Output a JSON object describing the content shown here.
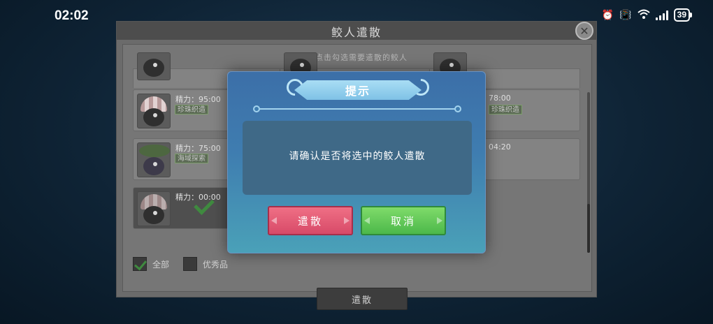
{
  "status_bar": {
    "time": "02:02",
    "icons": [
      "alarm-icon",
      "vibrate-icon",
      "wifi-icon",
      "signal-icon"
    ],
    "battery": "39"
  },
  "main_panel": {
    "title": "鲛人遣散",
    "close_icon": "close-icon",
    "hint": "请点击勾选需要遣散的鲛人",
    "cards": [
      {
        "stat": "精力：95:00",
        "tag": "珍珠织造"
      },
      {
        "stat": "精力：75:00",
        "tag": "海域探索"
      },
      {
        "stat": "精力：00:00",
        "selected": true
      }
    ],
    "right_stats": [
      "78:00",
      "04:20"
    ],
    "right_tag": "珍珠织造",
    "checkbox_all": {
      "label": "全部",
      "checked": true
    },
    "checkbox_quality": {
      "label": "优秀品",
      "checked": false
    },
    "dismiss_button": "遣散"
  },
  "modal": {
    "title": "提示",
    "message": "请确认是否将选中的鲛人遣散",
    "confirm_label": "遣散",
    "cancel_label": "取消"
  },
  "colors": {
    "modal_top": "#3c6fa8",
    "modal_bottom": "#4aa1b8",
    "confirm": "#d84a68",
    "cancel": "#4cb84a",
    "check": "#3f8a3f"
  }
}
